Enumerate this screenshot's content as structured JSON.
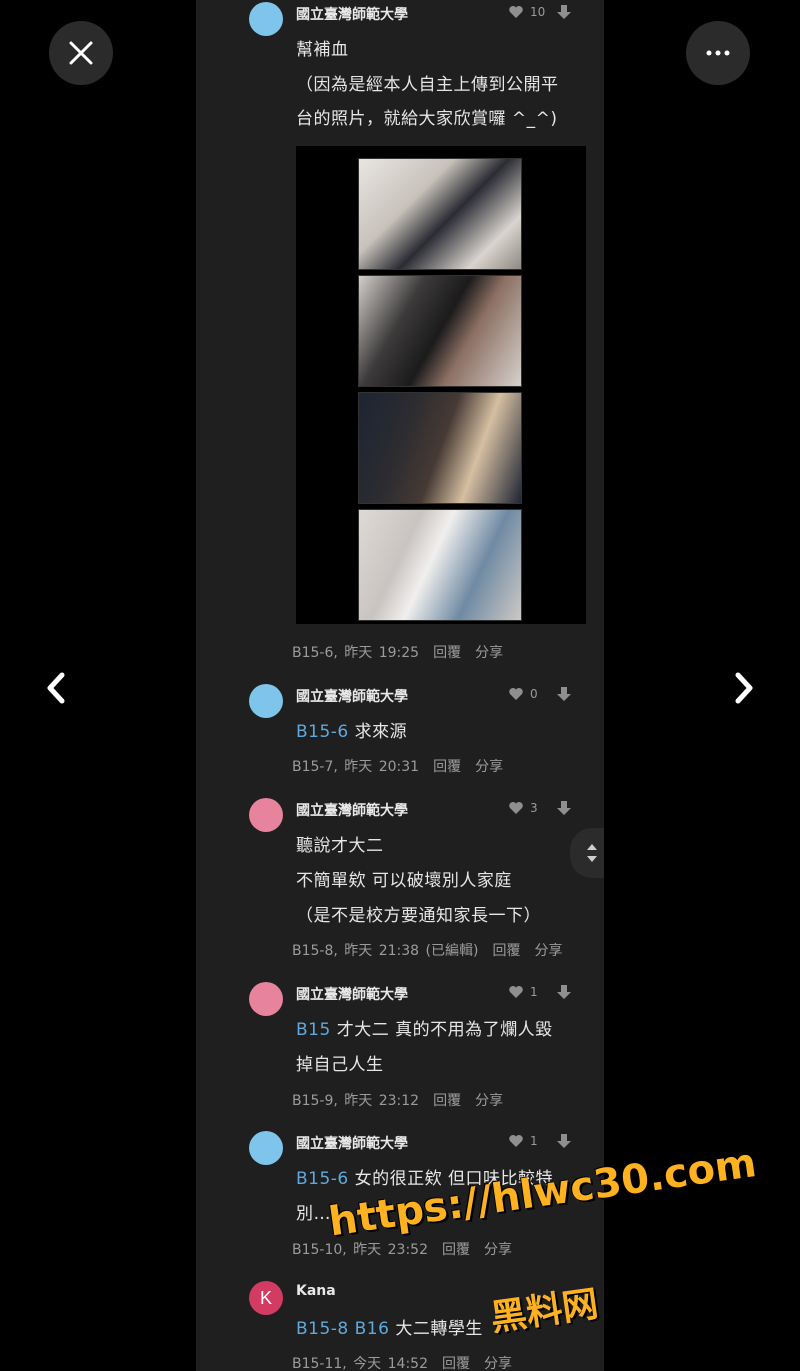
{
  "viewer": {
    "close_icon": "close-icon",
    "more_icon": "more-dots-icon",
    "prev_icon": "chevron-left-icon",
    "next_icon": "chevron-right-icon"
  },
  "actions": {
    "reply": "回覆",
    "share": "分享"
  },
  "comments": [
    {
      "author": "國立臺灣師範大學",
      "avatar": "blue",
      "likes": "10",
      "lines": [
        "幫補血",
        "（因為是經本人自主上傳到公開平",
        "台的照片，就給大家欣賞囉 ^_^)"
      ],
      "meta": "B15-6, 昨天 19:25"
    },
    {
      "author": "國立臺灣師範大學",
      "avatar": "blue",
      "likes": "0",
      "ref": "B15-6",
      "lines": [
        "求來源"
      ],
      "meta": "B15-7, 昨天 20:31"
    },
    {
      "author": "國立臺灣師範大學",
      "avatar": "pink",
      "likes": "3",
      "lines": [
        "聽說才大二",
        "不簡單欸 可以破壞別人家庭",
        "（是不是校方要通知家長一下）"
      ],
      "meta": "B15-8, 昨天 21:38 (已編輯)"
    },
    {
      "author": "國立臺灣師範大學",
      "avatar": "pink",
      "likes": "1",
      "ref": "B15",
      "lines": [
        "才大二 真的不用為了爛人毀",
        "掉自己人生"
      ],
      "meta": "B15-9, 昨天 23:12"
    },
    {
      "author": "國立臺灣師範大學",
      "avatar": "blue",
      "likes": "1",
      "ref": "B15-6",
      "lines": [
        "女的很正欸 但口味比較特",
        "別…"
      ],
      "meta": "B15-10, 昨天 23:52"
    },
    {
      "author": "Kana",
      "avatar_letter": "K",
      "ref": "B15-8 B16",
      "lines": [
        "大二轉學生"
      ],
      "meta": "B15-11, 今天 14:52"
    }
  ],
  "watermark": {
    "line1": "https://hlwc30.com",
    "line2": "黑料网",
    "color": "#ffb21f"
  }
}
